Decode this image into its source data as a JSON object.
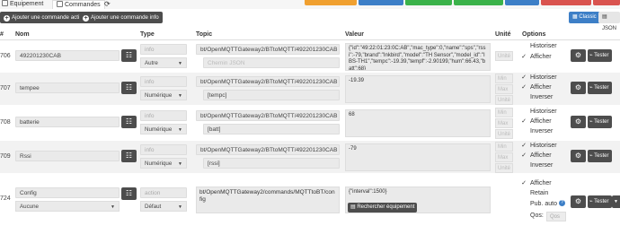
{
  "tabs": {
    "equipment": "Equipement",
    "commands": "Commandes"
  },
  "toolbar": {
    "add_action_label": "Ajouter une commande action",
    "add_info_label": "Ajouter une commande info",
    "classic_label": "Classic",
    "json_label": "JSON"
  },
  "header": {
    "col_id": "#",
    "col_name": "Nom",
    "col_type": "Type",
    "col_topic": "Topic",
    "col_value": "Valeur",
    "col_unit": "Unité",
    "col_options": "Options"
  },
  "rows": [
    {
      "id": "706",
      "name": "492201230CAB",
      "type": "info",
      "subtype": "Autre",
      "topic": "bt/OpenMQTTGateway2/BTtoMQTT/492201230CAB",
      "sub_field": "Chemin JSON",
      "value": "{\"id\":\"49:22:01:23:0C:AB\",\"mac_type\":0,\"name\":\"sps\",\"rssi\":-79,\"brand\":\"Inkbird\",\"model\":\"TH Sensor\",\"model_id\":\"IBS-TH1\",\"tempc\":-19.39,\"tempf\":-2.90199,\"hum\":66.43,\"batt\":68}",
      "unit": "Unité",
      "options": [
        {
          "label": "Historiser",
          "checked": false
        },
        {
          "label": "Afficher",
          "checked": true
        }
      ]
    },
    {
      "id": "707",
      "name": "tempee",
      "type": "info",
      "subtype": "Numérique",
      "topic": "bt/OpenMQTTGateway2/BTtoMQTT/492201230CAB",
      "sub_field": "[tempc]",
      "value": "-19.39",
      "min": "Min",
      "max": "Max",
      "unit": "Unité",
      "options": [
        {
          "label": "Historiser",
          "checked": true
        },
        {
          "label": "Afficher",
          "checked": true
        },
        {
          "label": "Inverser",
          "checked": false
        }
      ]
    },
    {
      "id": "708",
      "name": "batterie",
      "type": "info",
      "subtype": "Numérique",
      "topic": "bt/OpenMQTTGateway2/BTtoMQTT/492201230CAB",
      "sub_field": "[batt]",
      "value": "68",
      "min": "Min",
      "max": "Max",
      "unit": "Unité",
      "options": [
        {
          "label": "Historiser",
          "checked": false
        },
        {
          "label": "Afficher",
          "checked": true
        },
        {
          "label": "Inverser",
          "checked": false
        }
      ]
    },
    {
      "id": "709",
      "name": "Rssi",
      "type": "info",
      "subtype": "Numérique",
      "topic": "bt/OpenMQTTGateway2/BTtoMQTT/492201230CAB",
      "sub_field": "[rssi]",
      "value": "-79",
      "min": "Min",
      "max": "Max",
      "unit": "Unité",
      "options": [
        {
          "label": "Historiser",
          "checked": true
        },
        {
          "label": "Afficher",
          "checked": true
        },
        {
          "label": "Inverser",
          "checked": false
        }
      ]
    },
    {
      "id": "724",
      "name": "Config",
      "subtype_select": "Aucune",
      "type": "action",
      "subtype": "Défaut",
      "topic": "bt/OpenMQTTGateway2/commands/MQTTtoBT/config",
      "value": "{\"interval\":1500}",
      "scan_label": "Rechercher équipement",
      "options": [
        {
          "label": "Afficher",
          "checked": true
        },
        {
          "label": "Retain",
          "checked": false
        },
        {
          "label": "Pub. auto",
          "checked": false
        }
      ],
      "qos_label": "Qos:",
      "qos_value": "Qos"
    }
  ],
  "test_label": "Tester",
  "colors": {
    "dark_button": "#4d4d4d",
    "accent_blue": "#3d7fc7",
    "orange": "#f0a030",
    "green": "#3bb24a",
    "red": "#d9534f"
  }
}
